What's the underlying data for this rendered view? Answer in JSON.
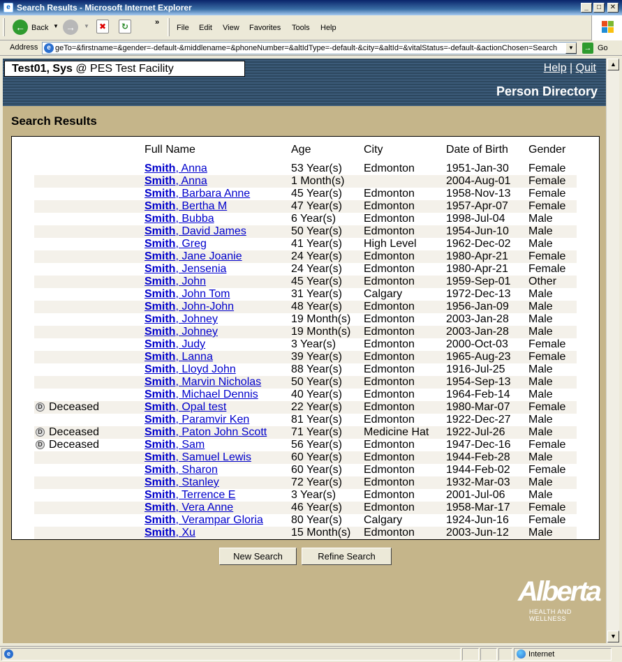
{
  "window": {
    "title": "Search Results - Microsoft Internet Explorer"
  },
  "toolbar": {
    "back_label": "Back",
    "menu": [
      "File",
      "Edit",
      "View",
      "Favorites",
      "Tools",
      "Help"
    ]
  },
  "address": {
    "label": "Address",
    "url": "geTo=&firstname=&gender=-default-&middlename=&phoneNumber=&altIdType=-default-&city=&altId=&vitalStatus=-default-&actionChosen=Search",
    "go_label": "Go"
  },
  "header": {
    "user": "Test01, Sys",
    "facility": "@ PES Test Facility",
    "help_link": "Help",
    "separator": "|",
    "quit_link": "Quit",
    "page_title": "Person Directory"
  },
  "results": {
    "heading": "Search Results",
    "columns": [
      "Full Name",
      "Age",
      "City",
      "Date of Birth",
      "Gender"
    ],
    "deceased_label": "Deceased",
    "rows": [
      {
        "status": "",
        "last": "Smith",
        "first": ", Anna",
        "age": "53 Year(s)",
        "city": "Edmonton",
        "dob": "1951-Jan-30",
        "gender": "Female"
      },
      {
        "status": "",
        "last": "Smith",
        "first": ", Anna",
        "age": "1 Month(s)",
        "city": "",
        "dob": "2004-Aug-01",
        "gender": "Female"
      },
      {
        "status": "",
        "last": "Smith",
        "first": ", Barbara Anne",
        "age": "45 Year(s)",
        "city": "Edmonton",
        "dob": "1958-Nov-13",
        "gender": "Female"
      },
      {
        "status": "",
        "last": "Smith",
        "first": ", Bertha M",
        "age": "47 Year(s)",
        "city": "Edmonton",
        "dob": "1957-Apr-07",
        "gender": "Female"
      },
      {
        "status": "",
        "last": "Smith",
        "first": ", Bubba",
        "age": "6 Year(s)",
        "city": "Edmonton",
        "dob": "1998-Jul-04",
        "gender": "Male"
      },
      {
        "status": "",
        "last": "Smith",
        "first": ", David James",
        "age": "50 Year(s)",
        "city": "Edmonton",
        "dob": "1954-Jun-10",
        "gender": "Male"
      },
      {
        "status": "",
        "last": "Smith",
        "first": ", Greg",
        "age": "41 Year(s)",
        "city": "High Level",
        "dob": "1962-Dec-02",
        "gender": "Male"
      },
      {
        "status": "",
        "last": "Smith",
        "first": ", Jane Joanie",
        "age": "24 Year(s)",
        "city": "Edmonton",
        "dob": "1980-Apr-21",
        "gender": "Female"
      },
      {
        "status": "",
        "last": "Smith",
        "first": ", Jensenia",
        "age": "24 Year(s)",
        "city": "Edmonton",
        "dob": "1980-Apr-21",
        "gender": "Female"
      },
      {
        "status": "",
        "last": "Smith",
        "first": ", John",
        "age": "45 Year(s)",
        "city": "Edmonton",
        "dob": "1959-Sep-01",
        "gender": "Other"
      },
      {
        "status": "",
        "last": "Smith",
        "first": ", John Tom",
        "age": "31 Year(s)",
        "city": "Calgary",
        "dob": "1972-Dec-13",
        "gender": "Male"
      },
      {
        "status": "",
        "last": "Smith",
        "first": ", John-John",
        "age": "48 Year(s)",
        "city": "Edmonton",
        "dob": "1956-Jan-09",
        "gender": "Male"
      },
      {
        "status": "",
        "last": "Smith",
        "first": ", Johney",
        "age": "19 Month(s)",
        "city": "Edmonton",
        "dob": "2003-Jan-28",
        "gender": "Male"
      },
      {
        "status": "",
        "last": "Smith",
        "first": ", Johney",
        "age": "19 Month(s)",
        "city": "Edmonton",
        "dob": "2003-Jan-28",
        "gender": "Male"
      },
      {
        "status": "",
        "last": "Smith",
        "first": ", Judy",
        "age": "3 Year(s)",
        "city": "Edmonton",
        "dob": "2000-Oct-03",
        "gender": "Female"
      },
      {
        "status": "",
        "last": "Smith",
        "first": ", Lanna",
        "age": "39 Year(s)",
        "city": "Edmonton",
        "dob": "1965-Aug-23",
        "gender": "Female"
      },
      {
        "status": "",
        "last": "Smith",
        "first": ", Lloyd John",
        "age": "88 Year(s)",
        "city": "Edmonton",
        "dob": "1916-Jul-25",
        "gender": "Male"
      },
      {
        "status": "",
        "last": "Smith",
        "first": ", Marvin Nicholas",
        "age": "50 Year(s)",
        "city": "Edmonton",
        "dob": "1954-Sep-13",
        "gender": "Male"
      },
      {
        "status": "",
        "last": "Smith",
        "first": ", Michael Dennis",
        "age": "40 Year(s)",
        "city": "Edmonton",
        "dob": "1964-Feb-14",
        "gender": "Male"
      },
      {
        "status": "Deceased",
        "last": "Smith",
        "first": ", Opal test",
        "age": "22 Year(s)",
        "city": "Edmonton",
        "dob": "1980-Mar-07",
        "gender": "Female"
      },
      {
        "status": "",
        "last": "Smith",
        "first": ", Paramvir Ken",
        "age": "81 Year(s)",
        "city": "Edmonton",
        "dob": "1922-Dec-27",
        "gender": "Male"
      },
      {
        "status": "Deceased",
        "last": "Smith",
        "first": ", Paton John Scott",
        "age": "71 Year(s)",
        "city": "Medicine Hat",
        "dob": "1922-Jul-26",
        "gender": "Male"
      },
      {
        "status": "Deceased",
        "last": "Smith",
        "first": ", Sam",
        "age": "56 Year(s)",
        "city": "Edmonton",
        "dob": "1947-Dec-16",
        "gender": "Female"
      },
      {
        "status": "",
        "last": "Smith",
        "first": ", Samuel Lewis",
        "age": "60 Year(s)",
        "city": "Edmonton",
        "dob": "1944-Feb-28",
        "gender": "Male"
      },
      {
        "status": "",
        "last": "Smith",
        "first": ", Sharon",
        "age": "60 Year(s)",
        "city": "Edmonton",
        "dob": "1944-Feb-02",
        "gender": "Female"
      },
      {
        "status": "",
        "last": "Smith",
        "first": ", Stanley",
        "age": "72 Year(s)",
        "city": "Edmonton",
        "dob": "1932-Mar-03",
        "gender": "Male"
      },
      {
        "status": "",
        "last": "Smith",
        "first": ", Terrence E",
        "age": "3 Year(s)",
        "city": "Edmonton",
        "dob": "2001-Jul-06",
        "gender": "Male"
      },
      {
        "status": "",
        "last": "Smith",
        "first": ", Vera Anne",
        "age": "46 Year(s)",
        "city": "Edmonton",
        "dob": "1958-Mar-17",
        "gender": "Female"
      },
      {
        "status": "",
        "last": "Smith",
        "first": ", Verampar Gloria",
        "age": "80 Year(s)",
        "city": "Calgary",
        "dob": "1924-Jun-16",
        "gender": "Female"
      },
      {
        "status": "",
        "last": "Smith",
        "first": ", Xu",
        "age": "15 Month(s)",
        "city": "Edmonton",
        "dob": "2003-Jun-12",
        "gender": "Male"
      }
    ]
  },
  "buttons": {
    "new_search": "New Search",
    "refine_search": "Refine Search"
  },
  "logo": {
    "word": "Alberta",
    "tagline": "HEALTH AND WELLNESS"
  },
  "status": {
    "zone": "Internet"
  },
  "colors": {
    "page_bg": "#c5b58a",
    "header_bg": "#2d4860",
    "link": "#0000cc"
  }
}
